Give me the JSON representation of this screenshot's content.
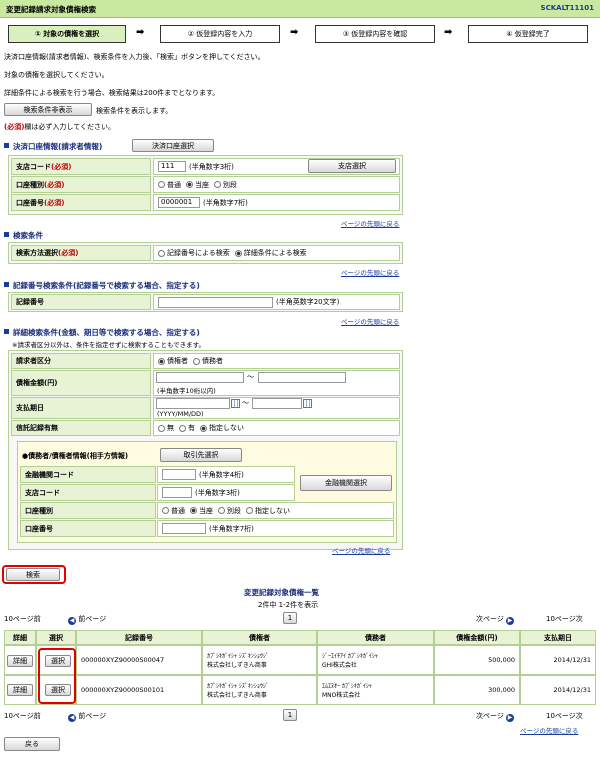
{
  "header": {
    "title": "変更記録請求対象債権検索",
    "code": "SCKALT11101"
  },
  "steps": [
    "① 対象の債権を選択",
    "② 仮登録内容を入力",
    "③ 仮登録内容を確認",
    "④ 仮登録完了"
  ],
  "intro": [
    "決済口座情報(請求者情報)、検索条件を入力後、「検索」ボタンを押してください。",
    "対象の債権を選択してください。",
    "詳細条件による検索を行う場合、検索結果は200件までとなります。"
  ],
  "toggle": {
    "button": "検索条件非表示",
    "note": "検索条件を表示します。"
  },
  "required_note": {
    "mark": "(必須)",
    "text": "欄は必ず入力してください。"
  },
  "account": {
    "heading": "決済口座情報(請求者情報)",
    "select_button": "決済口座選択",
    "branch_label": "支店コード",
    "branch_value": "111",
    "branch_hint": "(半角数字3桁)",
    "branch_button": "支店選択",
    "type_label": "口座種別",
    "type_options": [
      "普通",
      "当座",
      "別段"
    ],
    "number_label": "口座番号",
    "number_value": "0000001",
    "number_hint": "(半角数字7桁)",
    "req": "(必須)"
  },
  "back_to_top": "ページの先頭に戻る",
  "search": {
    "heading": "検索条件",
    "method_label": "検索方法選択",
    "req": "(必須)",
    "options": [
      "記録番号による検索",
      "詳細条件による検索"
    ]
  },
  "record": {
    "heading": "記録番号検索条件(記録番号で検索する場合、指定する)",
    "label": "記録番号",
    "hint": "(半角英数字20文字)"
  },
  "detail": {
    "heading": "詳細検索条件(金額、期日等で検索する場合、指定する)",
    "note": "※請求者区分以外は、条件を指定せずに検索することもできます。",
    "role_label": "請求者区分",
    "role_options": [
      "債権者",
      "債務者"
    ],
    "amount_label": "債権金額(円)",
    "amount_hint": "(半角数字10桁以内)",
    "tilde": "〜",
    "due_label": "支払期日",
    "due_hint": "(YYYY/MM/DD)",
    "credit_label": "信託記録有無",
    "credit_options": [
      "無",
      "有",
      "指定しない"
    ],
    "counter_heading": "●債務者/債権者情報(相手方情報)",
    "counter_button": "取引先選択",
    "bank_label": "金融機関コード",
    "bank_hint": "(半角数字4桁)",
    "bank_button": "金融機関選択",
    "branch_label": "支店コード",
    "branch_hint": "(半角数字3桁)",
    "acct_type_label": "口座種別",
    "acct_type_options": [
      "普通",
      "当座",
      "別段",
      "指定しない"
    ],
    "acct_no_label": "口座番号",
    "acct_no_hint": "(半角数字7桁)"
  },
  "search_button": "検索",
  "results": {
    "title": "変更記録対象債権一覧",
    "count": "2件中 1-2件を表示",
    "prev10": "10ページ前",
    "prev": "前ページ",
    "page": "1",
    "next": "次ページ",
    "next10": "10ページ次",
    "headers": [
      "詳細",
      "選択",
      "記録番号",
      "債権者",
      "債務者",
      "債権金額(円)",
      "支払期日"
    ],
    "detail_button": "詳細",
    "select_button": "選択",
    "rows": [
      {
        "record": "000000XYZ90000S00047",
        "creditor_kana": "ｶﾌﾞｼｷｶﾞｲｼｬ ｼｽﾞｷﾝｼｮｳｼﾞ",
        "creditor": "株式会社しずきん商事",
        "debtor_kana": "ｼﾞｰｴｲﾁｱｲ ｶﾌﾞｼｷｶﾞｲｼｬ",
        "debtor": "GHI株式会社",
        "amount": "500,000",
        "due": "2014/12/31"
      },
      {
        "record": "000000XYZ90000S00101",
        "creditor_kana": "ｶﾌﾞｼｷｶﾞｲｼｬ ｼｽﾞｷﾝｼｮｳｼﾞ",
        "creditor": "株式会社しずきん商事",
        "debtor_kana": "ｴﾑｴﾇｵｰ ｶﾌﾞｼｷｶﾞｲｼｬ",
        "debtor": "MNO株式会社",
        "amount": "300,000",
        "due": "2014/12/31"
      }
    ]
  },
  "back_button": "戻る"
}
